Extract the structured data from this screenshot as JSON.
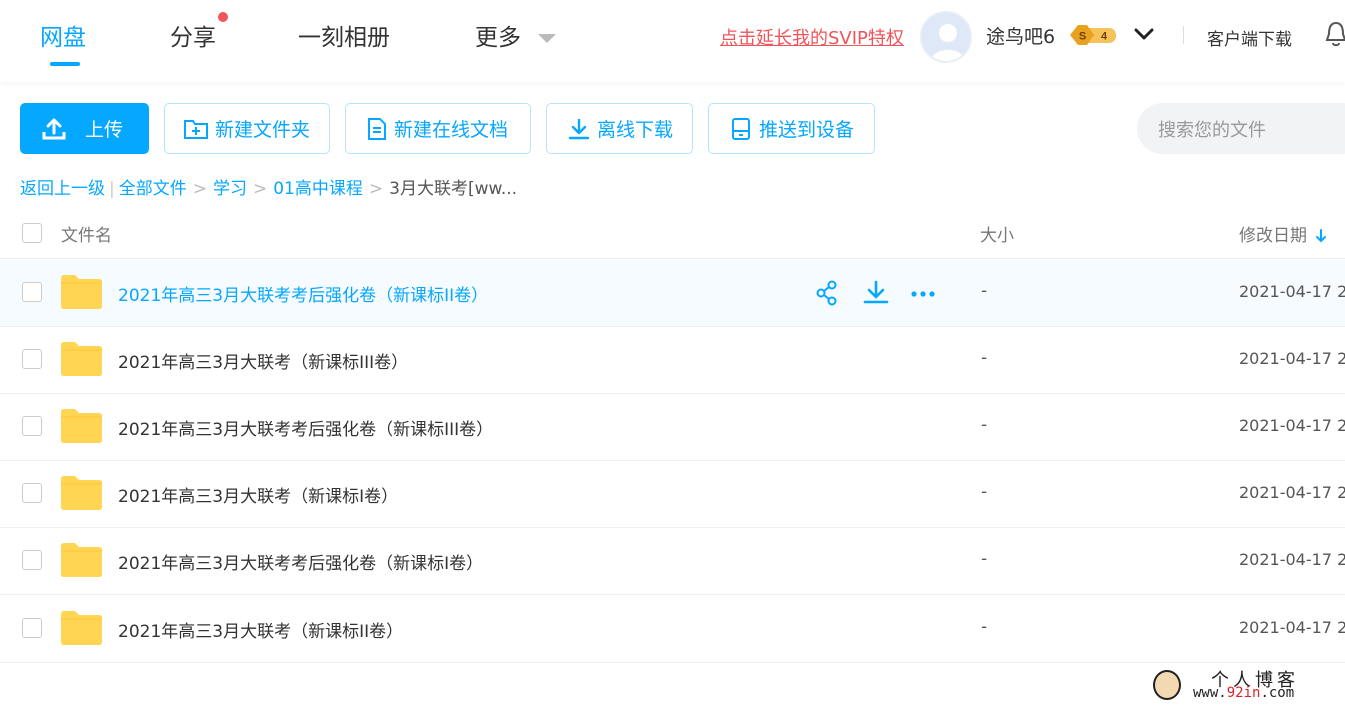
{
  "nav": {
    "tabs": [
      {
        "label": "网盘",
        "active": true
      },
      {
        "label": "分享",
        "has_dot": true
      },
      {
        "label": "一刻相册"
      },
      {
        "label": "更多"
      }
    ],
    "svip_link": "点击延长我的SVIP特权",
    "username": "途鸟吧6",
    "vip_badge": {
      "letter": "S",
      "level": "4"
    },
    "client_download": "客户端下载"
  },
  "toolbar": {
    "upload": "上传",
    "new_folder": "新建文件夹",
    "new_doc": "新建在线文档",
    "offline_download": "离线下载",
    "push_device": "推送到设备",
    "search_placeholder": "搜索您的文件"
  },
  "breadcrumb": {
    "back": "返回上一级",
    "sep_bar": "|",
    "items": [
      "全部文件",
      "学习",
      "01高中课程"
    ],
    "current": "3月大联考[ww...",
    "sep": ">"
  },
  "table": {
    "headers": {
      "name": "文件名",
      "size": "大小",
      "date": "修改日期"
    },
    "rows": [
      {
        "name": "2021年高三3月大联考考后强化卷（新课标II卷）",
        "size": "-",
        "date": "2021-04-17 2"
      },
      {
        "name": "2021年高三3月大联考（新课标III卷）",
        "size": "-",
        "date": "2021-04-17 2"
      },
      {
        "name": "2021年高三3月大联考考后强化卷（新课标III卷）",
        "size": "-",
        "date": "2021-04-17 2"
      },
      {
        "name": "2021年高三3月大联考（新课标I卷）",
        "size": "-",
        "date": "2021-04-17 2"
      },
      {
        "name": "2021年高三3月大联考考后强化卷（新课标I卷）",
        "size": "-",
        "date": "2021-04-17 2"
      },
      {
        "name": "2021年高三3月大联考（新课标II卷）",
        "size": "-",
        "date": "2021-04-17 2"
      }
    ]
  },
  "watermark": {
    "title": "个人博客",
    "url_pre": "www.",
    "url_mid": "92in",
    "url_post": ".com"
  },
  "colors": {
    "accent": "#06a7ff",
    "svip": "#f0545a",
    "folder": "#ffd553"
  }
}
